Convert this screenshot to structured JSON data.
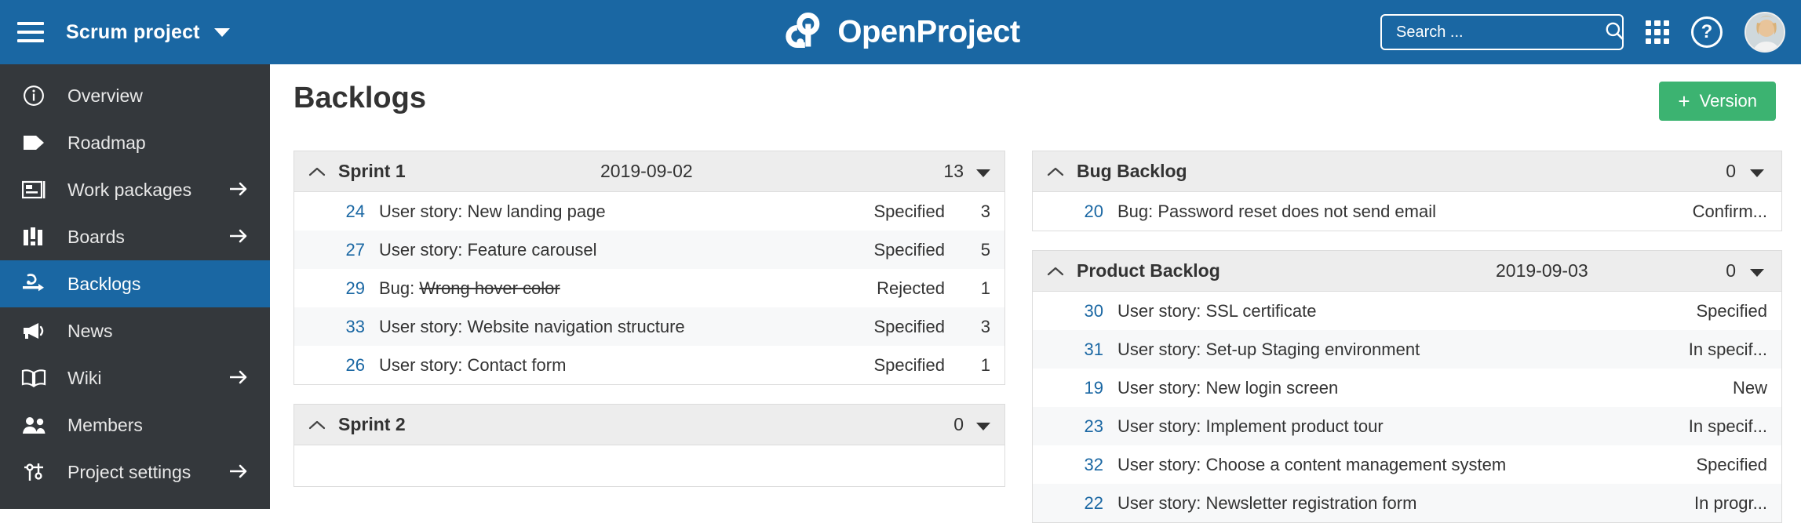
{
  "header": {
    "menu_icon": "hamburger-icon",
    "project_name": "Scrum project",
    "logo_text": "OpenProject",
    "logo_icon": "openproject-logo-icon",
    "search_placeholder": "Search ...",
    "search_value": "",
    "search_icon": "search-icon",
    "modules_icon": "grid-modules-icon",
    "help_icon": "help-icon",
    "help_glyph": "?",
    "avatar_icon": "user-avatar",
    "background_color": "#1A67A3"
  },
  "sidebar": {
    "background_color": "#34383C",
    "active_color": "#1A67A3",
    "items": [
      {
        "label": "Overview",
        "icon": "info-circle-icon",
        "arrow": false,
        "active": false
      },
      {
        "label": "Roadmap",
        "icon": "tag-icon",
        "arrow": false,
        "active": false
      },
      {
        "label": "Work packages",
        "icon": "work-package-icon",
        "arrow": true,
        "active": false
      },
      {
        "label": "Boards",
        "icon": "boards-icon",
        "arrow": true,
        "active": false
      },
      {
        "label": "Backlogs",
        "icon": "backlogs-icon",
        "arrow": false,
        "active": true
      },
      {
        "label": "News",
        "icon": "megaphone-icon",
        "arrow": false,
        "active": false
      },
      {
        "label": "Wiki",
        "icon": "book-icon",
        "arrow": true,
        "active": false
      },
      {
        "label": "Members",
        "icon": "members-icon",
        "arrow": false,
        "active": false
      },
      {
        "label": "Project settings",
        "icon": "settings-gear-icon",
        "arrow": true,
        "active": false
      }
    ]
  },
  "main": {
    "title": "Backlogs",
    "version_button": {
      "label": "Version",
      "plus": "+",
      "color": "#3CB371"
    }
  },
  "backlogs": {
    "left": [
      {
        "name": "Sprint 1",
        "date": "2019-09-02",
        "count": "13",
        "collapse_icon": "chevron-up-icon",
        "menu_icon": "caret-down-icon",
        "columns": [
          "id",
          "subject",
          "status",
          "points"
        ],
        "rows": [
          {
            "id": "24",
            "subject": "User story: New landing page",
            "struck": "",
            "status": "Specified",
            "points": "3"
          },
          {
            "id": "27",
            "subject": "User story: Feature carousel",
            "struck": "",
            "status": "Specified",
            "points": "5"
          },
          {
            "id": "29",
            "subject": "Bug: ",
            "struck": "Wrong hover color",
            "status": "Rejected",
            "points": "1"
          },
          {
            "id": "33",
            "subject": "User story: Website navigation structure",
            "struck": "",
            "status": "Specified",
            "points": "3"
          },
          {
            "id": "26",
            "subject": "User story: Contact form",
            "struck": "",
            "status": "Specified",
            "points": "1"
          }
        ]
      },
      {
        "name": "Sprint 2",
        "date": "",
        "count": "0",
        "collapse_icon": "chevron-up-icon",
        "menu_icon": "caret-down-icon",
        "columns": [
          "id",
          "subject",
          "status",
          "points"
        ],
        "rows": []
      }
    ],
    "right": [
      {
        "name": "Bug Backlog",
        "date": "",
        "count": "0",
        "collapse_icon": "chevron-up-icon",
        "menu_icon": "caret-down-icon",
        "columns": [
          "id",
          "subject",
          "status"
        ],
        "rows": [
          {
            "id": "20",
            "subject": "Bug: Password reset does not send email",
            "struck": "",
            "status": "Confirm...",
            "points": ""
          }
        ]
      },
      {
        "name": "Product Backlog",
        "date": "2019-09-03",
        "count": "0",
        "collapse_icon": "chevron-up-icon",
        "menu_icon": "caret-down-icon",
        "columns": [
          "id",
          "subject",
          "status"
        ],
        "rows": [
          {
            "id": "30",
            "subject": "User story: SSL certificate",
            "struck": "",
            "status": "Specified",
            "points": ""
          },
          {
            "id": "31",
            "subject": "User story: Set-up Staging environment",
            "struck": "",
            "status": "In specif...",
            "points": ""
          },
          {
            "id": "19",
            "subject": "User story: New login screen",
            "struck": "",
            "status": "New",
            "points": ""
          },
          {
            "id": "23",
            "subject": "User story: Implement product tour",
            "struck": "",
            "status": "In specif...",
            "points": ""
          },
          {
            "id": "32",
            "subject": "User story: Choose a content management system",
            "struck": "",
            "status": "Specified",
            "points": ""
          },
          {
            "id": "22",
            "subject": "User story: Newsletter registration form",
            "struck": "",
            "status": "In progr...",
            "points": ""
          }
        ]
      }
    ]
  }
}
